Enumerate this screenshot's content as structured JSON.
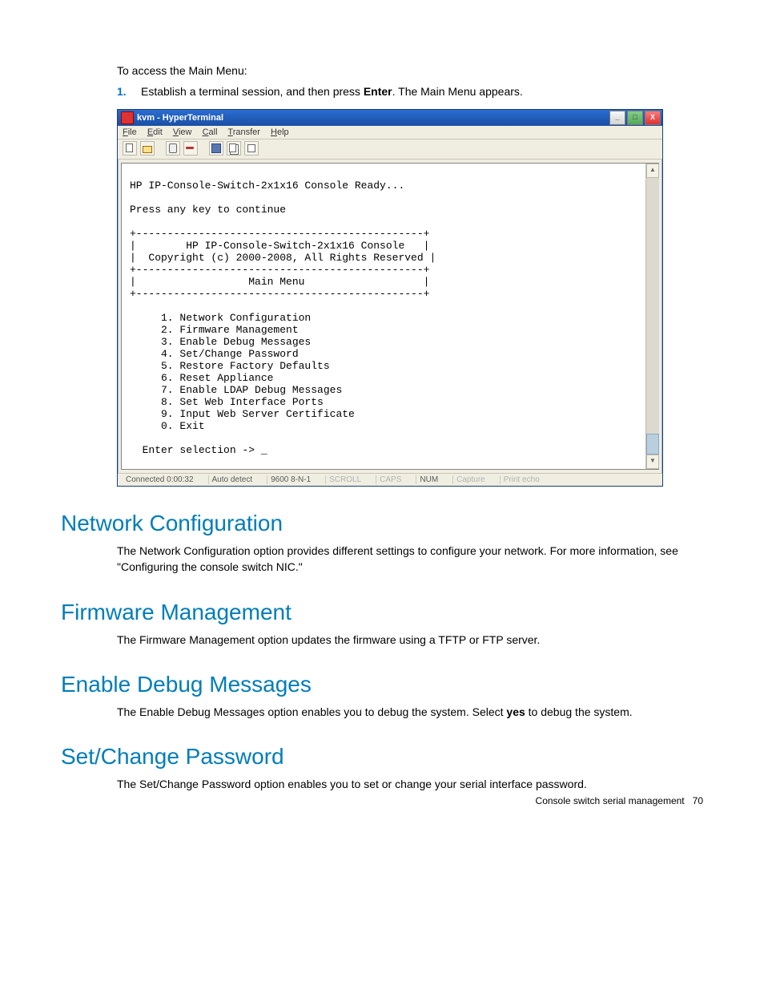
{
  "intro": "To access the Main Menu:",
  "step": {
    "num": "1.",
    "pre": "Establish a terminal session, and then press ",
    "bold": "Enter",
    "post": ". The Main Menu appears."
  },
  "window": {
    "title": "kvm - HyperTerminal",
    "menu": {
      "file": "File",
      "edit": "Edit",
      "view": "View",
      "call": "Call",
      "transfer": "Transfer",
      "help": "Help"
    },
    "terminal": "HP IP-Console-Switch-2x1x16 Console Ready...\n\nPress any key to continue\n\n+----------------------------------------------+\n|        HP IP-Console-Switch-2x1x16 Console   |\n|  Copyright (c) 2000-2008, All Rights Reserved |\n+----------------------------------------------+\n|                  Main Menu                   |\n+----------------------------------------------+\n\n     1. Network Configuration\n     2. Firmware Management\n     3. Enable Debug Messages\n     4. Set/Change Password\n     5. Restore Factory Defaults\n     6. Reset Appliance\n     7. Enable LDAP Debug Messages\n     8. Set Web Interface Ports\n     9. Input Web Server Certificate\n     0. Exit\n\n  Enter selection -> _",
    "status": {
      "connected": "Connected 0:00:32",
      "detect": "Auto detect",
      "baud": "9600 8-N-1",
      "scroll": "SCROLL",
      "caps": "CAPS",
      "num": "NUM",
      "capture": "Capture",
      "printecho": "Print echo"
    }
  },
  "sec1": {
    "title": "Network Configuration",
    "text": "The Network Configuration option provides different settings to configure your network. For more information, see \"Configuring the console switch NIC.\""
  },
  "sec2": {
    "title": "Firmware Management",
    "text": "The Firmware Management option updates the firmware using a TFTP or FTP server."
  },
  "sec3": {
    "title": "Enable Debug Messages",
    "pre": "The Enable Debug Messages option enables you to debug the system. Select ",
    "bold": "yes",
    "post": " to debug the system."
  },
  "sec4": {
    "title": "Set/Change Password",
    "text": "The Set/Change Password option enables you to set or change your serial interface password."
  },
  "footer": {
    "label": "Console switch serial management",
    "page": "70"
  }
}
